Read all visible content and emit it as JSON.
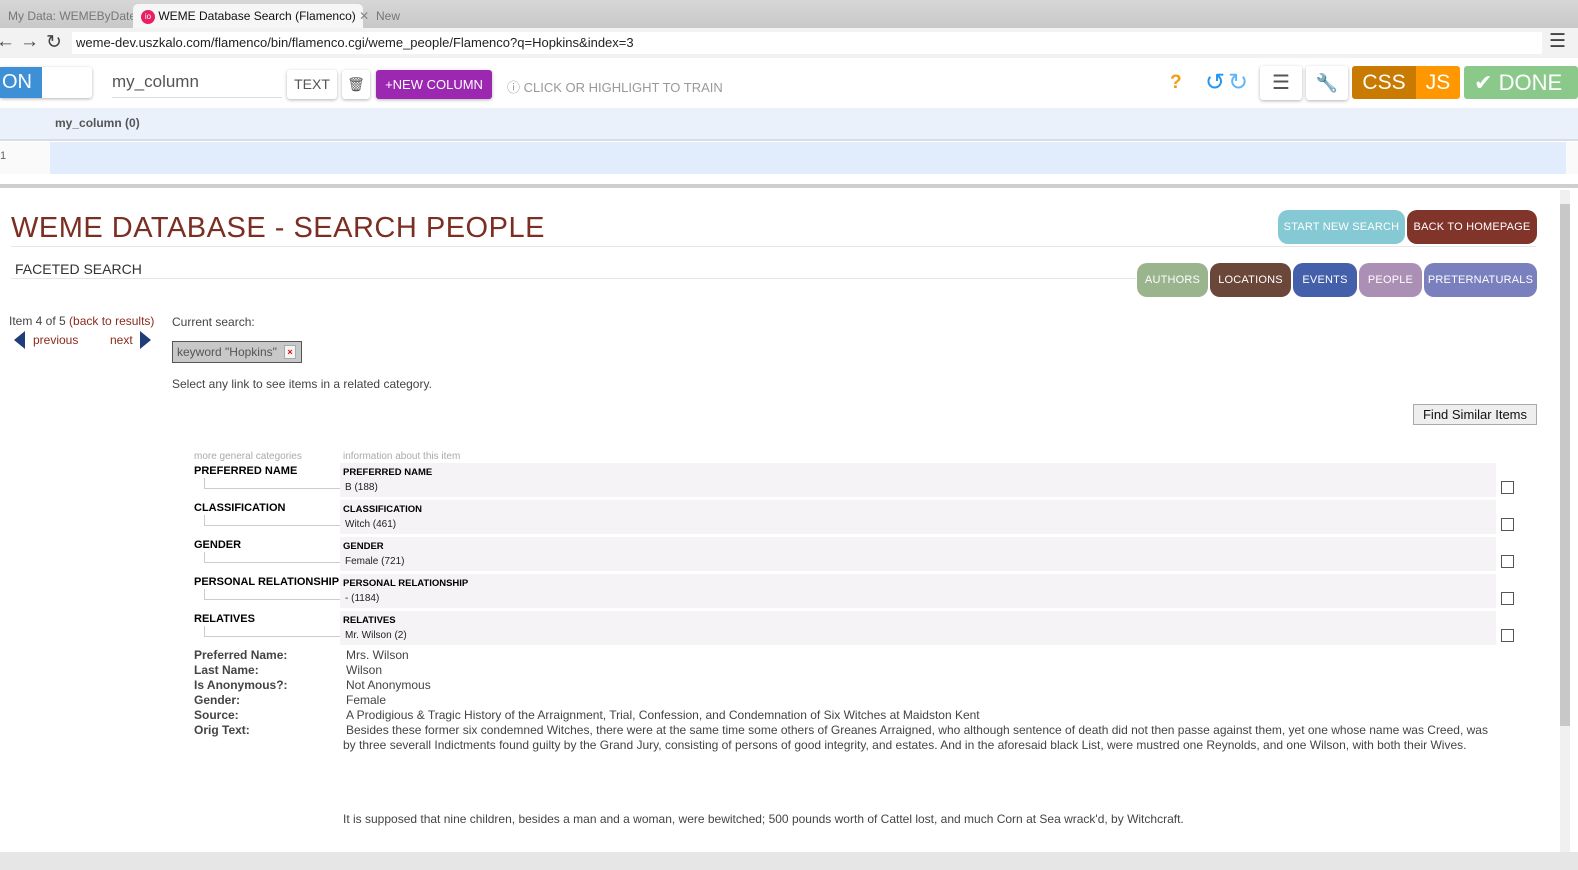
{
  "browser": {
    "tabs": [
      "My Data: WEMEByDate",
      "WEME Database Search (Flamenco)",
      "New"
    ],
    "url": "weme-dev.uszkalo.com/flamenco/bin/flamenco.cgi/weme_people/Flamenco?q=Hopkins&index=3"
  },
  "toolbar": {
    "toggle": "ON",
    "column_name": "my_column",
    "text_btn": "TEXT",
    "new_column": "NEW COLUMN",
    "hint": "CLICK OR HIGHLIGHT TO TRAIN",
    "help": "?",
    "css": "CSS",
    "js": "JS",
    "done": "DONE"
  },
  "table": {
    "header": "my_column (0)",
    "row_num": "1"
  },
  "page": {
    "title": "WEME DATABASE - SEARCH PEOPLE",
    "subtitle": "FACETED SEARCH",
    "start_new": "START NEW SEARCH",
    "back_home": "BACK TO HOMEPAGE",
    "categories": [
      "AUTHORS",
      "LOCATIONS",
      "EVENTS",
      "PEOPLE",
      "PRETERNATURALS"
    ],
    "item_pos": "Item 4 of 5",
    "back_results": "(back to results)",
    "previous": "previous",
    "next": "next",
    "current_search": "Current search:",
    "keyword": "keyword \"Hopkins\"",
    "select_hint": "Select any link to see items in a related category.",
    "find_similar": "Find Similar Items",
    "col_general": "more general categories",
    "col_info": "information about this item",
    "facets": [
      {
        "label": "PREFERRED NAME",
        "value": "B (188)"
      },
      {
        "label": "CLASSIFICATION",
        "value": "Witch (461)"
      },
      {
        "label": "GENDER",
        "value": "Female (721)"
      },
      {
        "label": "PERSONAL RELATIONSHIP",
        "value": "- (1184)"
      },
      {
        "label": "RELATIVES",
        "value": "Mr. Wilson (2)"
      }
    ],
    "details": [
      {
        "label": "Preferred Name:",
        "value": "Mrs. Wilson"
      },
      {
        "label": "Last Name:",
        "value": "Wilson"
      },
      {
        "label": "Is Anonymous?:",
        "value": "Not Anonymous"
      },
      {
        "label": "Gender:",
        "value": "Female"
      },
      {
        "label": "Source:",
        "value": "A Prodigious & Tragic History of the Arraignment, Trial, Confession, and Condemnation of Six Witches at Maidston Kent"
      },
      {
        "label": "Orig Text:",
        "value": "Besides these former six condemned Witches, there were at the same time some others of Greanes Arraigned, who although sentence of death did not then passe against them, yet one whose name was Creed, was by three severall Indictments found guilty by the Grand Jury, consisting of persons of good integrity, and estates. And in the aforesaid black List, were mustred one Reynolds, and one Wilson, with both their Wives."
      }
    ],
    "orig_text_2": "It is supposed that nine children, besides a man and a woman, were bewitched; 500 pounds worth of Cattel lost, and much Corn at Sea wrack'd, by Witchcraft."
  },
  "colors": {
    "title": "#7b2e22",
    "purple": "#9c27b0",
    "css": "#c97a00",
    "js": "#ff9800",
    "done": "#8bc98b"
  }
}
